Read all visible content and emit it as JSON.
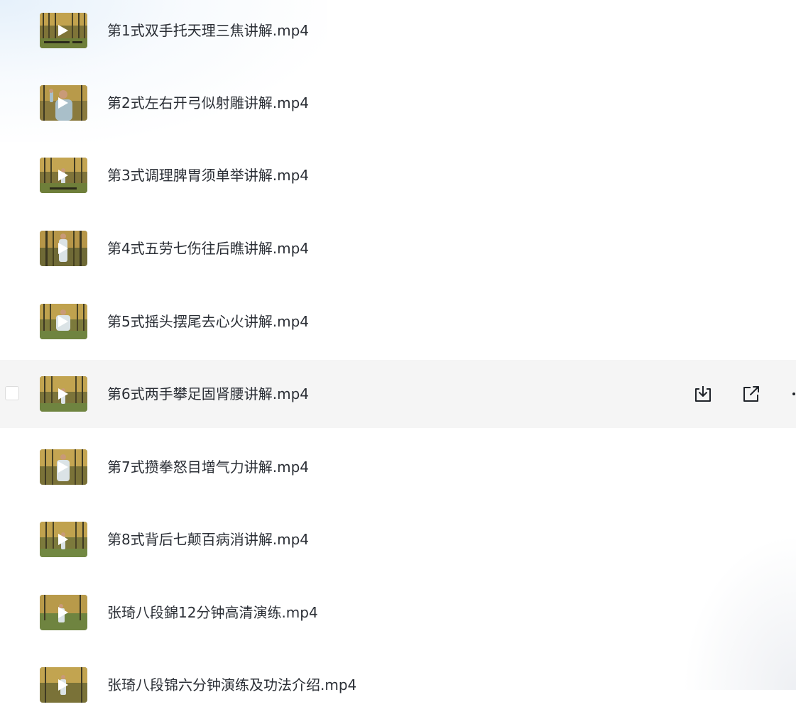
{
  "files": [
    {
      "name": "第1式双手托天理三焦讲解.mp4",
      "hovered": false,
      "thumb": "autumn-grove-caption-icon"
    },
    {
      "name": "第2式左右开弓似射雕讲解.mp4",
      "hovered": false,
      "thumb": "person-closeup-icon"
    },
    {
      "name": "第3式调理脾胃须单举讲解.mp4",
      "hovered": false,
      "thumb": "autumn-grove-caption-icon"
    },
    {
      "name": "第4式五劳七伤往后瞧讲解.mp4",
      "hovered": false,
      "thumb": "person-standing-icon"
    },
    {
      "name": "第5式摇头摆尾去心火讲解.mp4",
      "hovered": false,
      "thumb": "person-standing-icon"
    },
    {
      "name": "第6式两手攀足固肾腰讲解.mp4",
      "hovered": true,
      "thumb": "person-standing-icon"
    },
    {
      "name": "第7式攒拳怒目增气力讲解.mp4",
      "hovered": false,
      "thumb": "person-standing-icon"
    },
    {
      "name": "第8式背后七颠百病消讲解.mp4",
      "hovered": false,
      "thumb": "person-standing-icon"
    },
    {
      "name": "张琦八段錦12分钟高清演练.mp4",
      "hovered": false,
      "thumb": "person-standing-icon"
    },
    {
      "name": "张琦八段锦六分钟演练及功法介绍.mp4",
      "hovered": false,
      "thumb": "person-standing-icon"
    }
  ],
  "row_actions": {
    "download_icon": "download-icon",
    "share_icon": "share-icon",
    "more_icon": "more-icon"
  },
  "colors": {
    "hover_background": "#f5f5f5",
    "text": "#2b2f36",
    "icon": "#1f2329"
  }
}
